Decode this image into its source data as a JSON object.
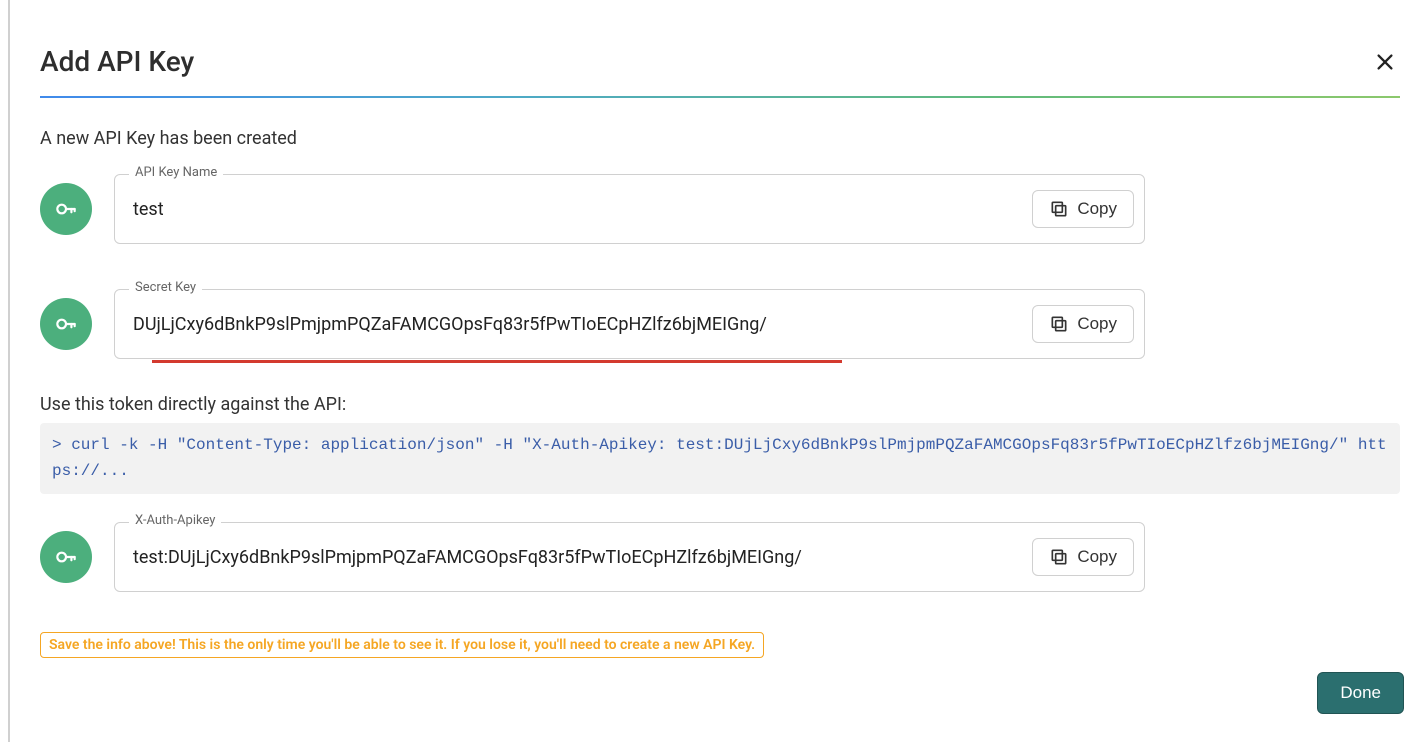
{
  "dialog": {
    "title": "Add API Key",
    "subtitle": "A new API Key has been created",
    "token_label": "Use this token directly against the API:",
    "code_line": "> curl -k -H \"Content-Type: application/json\" -H \"X-Auth-Apikey: test:DUjLjCxy6dBnkP9slPmjpmPQZaFAMCGOpsFq83r5fPwTIoECpHZlfz6bjMEIGng/\" https://...",
    "warning": "Save the info above! This is the only time you'll be able to see it. If you lose it, you'll need to create a new API Key.",
    "done_label": "Done"
  },
  "fields": {
    "name": {
      "label": "API Key Name",
      "value": "test",
      "copy": "Copy"
    },
    "secret": {
      "label": "Secret Key",
      "value": "DUjLjCxy6dBnkP9slPmjpmPQZaFAMCGOpsFq83r5fPwTIoECpHZlfz6bjMEIGng/",
      "copy": "Copy"
    },
    "auth": {
      "label": "X-Auth-Apikey",
      "value": "test:DUjLjCxy6dBnkP9slPmjpmPQZaFAMCGOpsFq83r5fPwTIoECpHZlfz6bjMEIGng/",
      "copy": "Copy"
    }
  },
  "icons": {
    "close": "close-icon",
    "key": "key-icon",
    "copy": "copy-icon"
  }
}
